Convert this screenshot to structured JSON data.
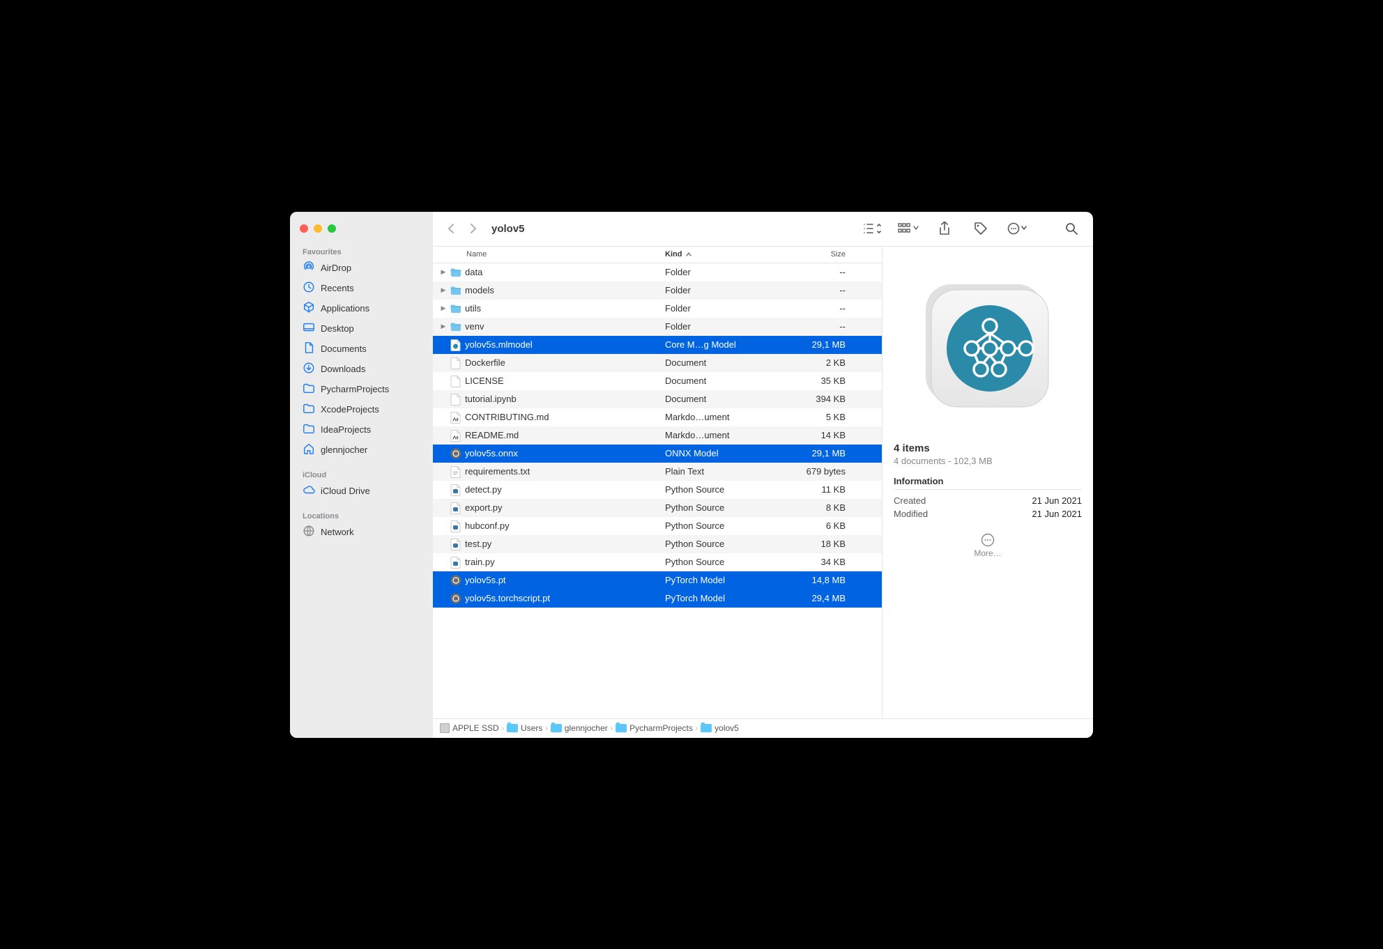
{
  "title": "yolov5",
  "sidebar": {
    "sections": [
      {
        "label": "Favourites",
        "items": [
          {
            "icon": "airdrop",
            "label": "AirDrop"
          },
          {
            "icon": "recents",
            "label": "Recents"
          },
          {
            "icon": "apps",
            "label": "Applications"
          },
          {
            "icon": "desktop",
            "label": "Desktop"
          },
          {
            "icon": "documents",
            "label": "Documents"
          },
          {
            "icon": "downloads",
            "label": "Downloads"
          },
          {
            "icon": "folder",
            "label": "PycharmProjects"
          },
          {
            "icon": "folder",
            "label": "XcodeProjects"
          },
          {
            "icon": "folder",
            "label": "IdeaProjects"
          },
          {
            "icon": "home",
            "label": "glennjocher"
          }
        ]
      },
      {
        "label": "iCloud",
        "items": [
          {
            "icon": "cloud",
            "label": "iCloud Drive"
          }
        ]
      },
      {
        "label": "Locations",
        "items": [
          {
            "icon": "globe",
            "label": "Network"
          }
        ]
      }
    ]
  },
  "columns": {
    "name": "Name",
    "kind": "Kind",
    "size": "Size"
  },
  "files": [
    {
      "name": "data",
      "kind": "Folder",
      "size": "--",
      "icon": "folder",
      "exp": true
    },
    {
      "name": "models",
      "kind": "Folder",
      "size": "--",
      "icon": "folder",
      "exp": true
    },
    {
      "name": "utils",
      "kind": "Folder",
      "size": "--",
      "icon": "folder",
      "exp": true
    },
    {
      "name": "venv",
      "kind": "Folder",
      "size": "--",
      "icon": "folder",
      "exp": true
    },
    {
      "name": "yolov5s.mlmodel",
      "kind": "Core M…g Model",
      "size": "29,1 MB",
      "icon": "ml",
      "sel": true
    },
    {
      "name": "Dockerfile",
      "kind": "Document",
      "size": "2 KB",
      "icon": "doc"
    },
    {
      "name": "LICENSE",
      "kind": "Document",
      "size": "35 KB",
      "icon": "doc"
    },
    {
      "name": "tutorial.ipynb",
      "kind": "Document",
      "size": "394 KB",
      "icon": "doc"
    },
    {
      "name": "CONTRIBUTING.md",
      "kind": "Markdo…ument",
      "size": "5 KB",
      "icon": "md"
    },
    {
      "name": "README.md",
      "kind": "Markdo…ument",
      "size": "14 KB",
      "icon": "md"
    },
    {
      "name": "yolov5s.onnx",
      "kind": "ONNX Model",
      "size": "29,1 MB",
      "icon": "onnx",
      "sel": true
    },
    {
      "name": "requirements.txt",
      "kind": "Plain Text",
      "size": "679 bytes",
      "icon": "txt"
    },
    {
      "name": "detect.py",
      "kind": "Python Source",
      "size": "11 KB",
      "icon": "py"
    },
    {
      "name": "export.py",
      "kind": "Python Source",
      "size": "8 KB",
      "icon": "py"
    },
    {
      "name": "hubconf.py",
      "kind": "Python Source",
      "size": "6 KB",
      "icon": "py"
    },
    {
      "name": "test.py",
      "kind": "Python Source",
      "size": "18 KB",
      "icon": "py"
    },
    {
      "name": "train.py",
      "kind": "Python Source",
      "size": "34 KB",
      "icon": "py"
    },
    {
      "name": "yolov5s.pt",
      "kind": "PyTorch Model",
      "size": "14,8 MB",
      "icon": "pt",
      "sel": true
    },
    {
      "name": "yolov5s.torchscript.pt",
      "kind": "PyTorch Model",
      "size": "29,4 MB",
      "icon": "pt",
      "sel": true
    }
  ],
  "preview": {
    "count_line": "4 items",
    "summary": "4 documents - 102,3 MB",
    "info_label": "Information",
    "created_label": "Created",
    "created": "21 Jun 2021",
    "modified_label": "Modified",
    "modified": "21 Jun 2021",
    "more": "More…"
  },
  "path": [
    "APPLE SSD",
    "Users",
    "glennjocher",
    "PycharmProjects",
    "yolov5"
  ]
}
